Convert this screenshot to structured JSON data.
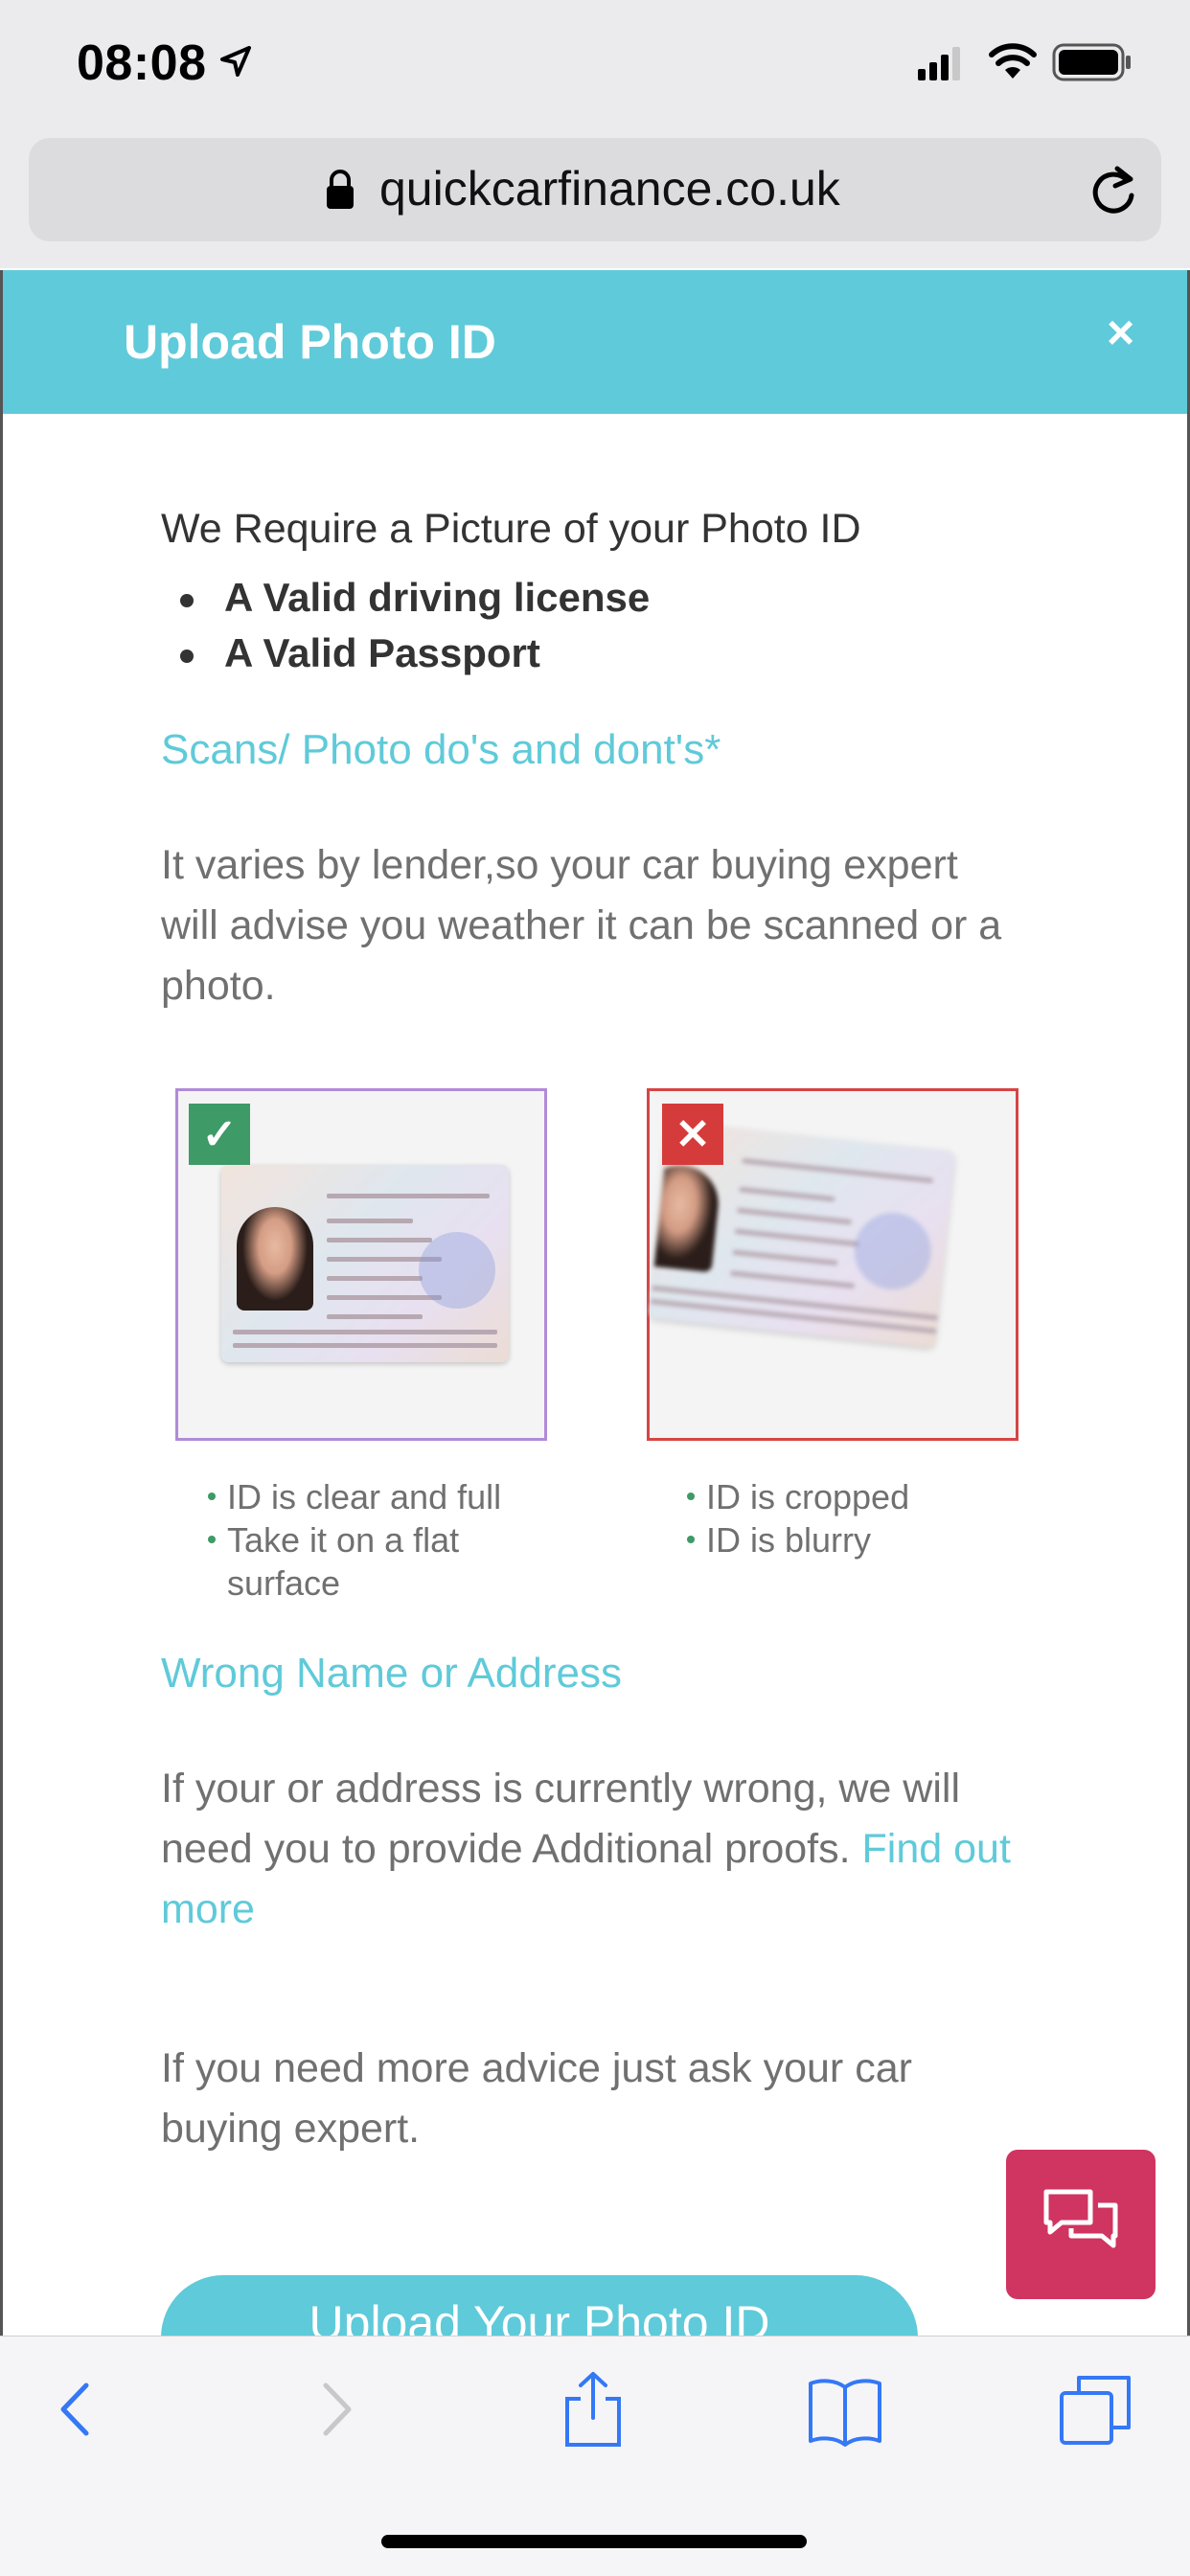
{
  "status_bar": {
    "time": "08:08",
    "icons": [
      "location-arrow-icon",
      "signal-icon",
      "wifi-icon",
      "battery-icon"
    ]
  },
  "browser": {
    "url": "quickcarfinance.co.uk",
    "icons": [
      "lock-icon",
      "reload-icon"
    ]
  },
  "modal": {
    "title": "Upload Photo ID",
    "close_symbol": "×",
    "intro": "We Require a Picture of your Photo ID",
    "requirements": [
      "A Valid driving license",
      "A Valid Passport"
    ],
    "scans_heading": "Scans/ Photo do's and dont's*",
    "scans_text": "It varies by lender,so your car buying expert will advise you weather it can be scanned or a photo.",
    "good_example": {
      "badge": "✓",
      "points": [
        "ID is clear and full",
        "Take it on a flat surface"
      ]
    },
    "bad_example": {
      "badge": "✕",
      "points": [
        "ID is cropped",
        "ID is blurry"
      ]
    },
    "wrong_heading": "Wrong Name or Address",
    "wrong_text": "If your or address is currently wrong, we will need you to provide Additional proofs.",
    "wrong_link": "Find out more",
    "advice_text": "If you need more advice just ask your car buying expert.",
    "upload_button": "Upload Your Photo ID"
  },
  "chat": {
    "icon": "chat-bubbles-icon"
  },
  "toolbar": {
    "items": [
      "back-icon",
      "forward-icon",
      "share-icon",
      "bookmarks-icon",
      "tabs-icon"
    ]
  },
  "colors": {
    "accent": "#5fcad9",
    "chat": "#d03461",
    "good": "#3e9a67",
    "bad": "#d63b3b",
    "ios_blue": "#3478f6"
  }
}
